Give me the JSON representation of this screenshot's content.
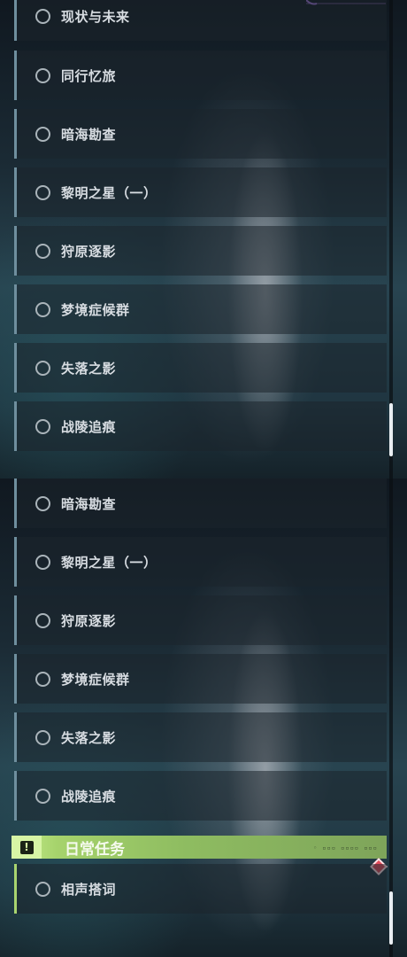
{
  "panels": {
    "top": {
      "items": [
        {
          "label": "现状与未来"
        },
        {
          "label": "同行忆旅"
        },
        {
          "label": "暗海勘查"
        },
        {
          "label": "黎明之星（一）"
        },
        {
          "label": "狩原逐影"
        },
        {
          "label": "梦境症候群"
        },
        {
          "label": "失落之影"
        },
        {
          "label": "战陵追痕"
        }
      ]
    },
    "bottom": {
      "items": [
        {
          "label": "暗海勘查"
        },
        {
          "label": "黎明之星（一）"
        },
        {
          "label": "狩原逐影"
        },
        {
          "label": "梦境症候群"
        },
        {
          "label": "失落之影"
        },
        {
          "label": "战陵追痕"
        }
      ],
      "section": {
        "title": "日常任务",
        "badge_glyph": "!",
        "items": [
          {
            "label": "相声搭词"
          }
        ]
      }
    }
  },
  "colors": {
    "item_border": "#6f8f9e",
    "daily_accent": "#a9d46f",
    "alert_diamond": "#e24d5c"
  },
  "icons": {
    "item_marker": "circle-outline-icon",
    "section_badge": "exclamation-icon",
    "alert": "red-diamond-icon"
  }
}
